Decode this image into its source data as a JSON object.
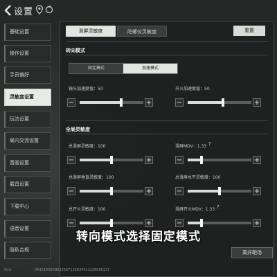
{
  "header": {
    "title": "设置"
  },
  "menu": [
    {
      "label": "基础设置"
    },
    {
      "label": "操作设置"
    },
    {
      "label": "手员偏好"
    },
    {
      "label": "灵敏度设置"
    },
    {
      "label": "玩法设置"
    },
    {
      "label": "局内交流设置"
    },
    {
      "label": "音画设置"
    },
    {
      "label": "载具设置"
    },
    {
      "label": "下载中心"
    },
    {
      "label": "语音设置"
    },
    {
      "label": "隐私合规"
    }
  ],
  "tabs": [
    "滑屏灵敏度",
    "陀螺仪灵敏度"
  ],
  "reset_label": "重置",
  "turn_mode": {
    "title": "转向模式",
    "options": [
      "固定模式",
      "加速模式"
    ],
    "selected": "加速模式"
  },
  "accel_sliders": [
    {
      "label": "镜头加速度值：50",
      "value": 50
    },
    {
      "label": "开火加速度值：50",
      "value": 50
    }
  ],
  "global": {
    "title": "全局灵敏度",
    "sliders": [
      {
        "label": "总滑屏灵敏度：100",
        "value": 100,
        "help": false
      },
      {
        "label": "滑屏MDV：1.33",
        "value": 1.33,
        "help": true
      },
      {
        "label": "总滑屏垂直灵敏度：100",
        "value": 100,
        "help": false
      },
      {
        "label": "总滑屏水平灵敏度：100",
        "value": 100,
        "help": false
      },
      {
        "label": "总开火灵敏度：100",
        "value": 100,
        "help": false
      },
      {
        "label": "滑屏开火MDV：1.33",
        "value": 1.33,
        "help": true
      }
    ]
  },
  "subtitle": "转向模式选择固定模式",
  "exit_label": "离开靶场",
  "status": {
    "network": "5ms",
    "id": "0A1516685B6225671228345L1226066137"
  }
}
